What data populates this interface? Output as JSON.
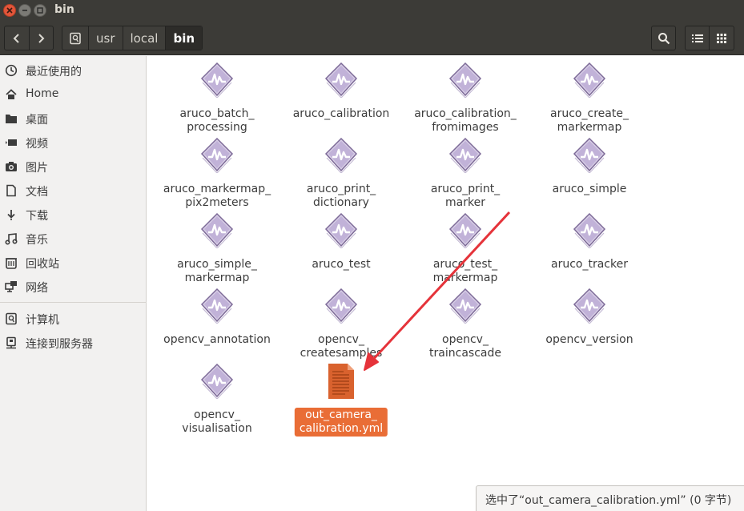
{
  "window": {
    "title": "bin"
  },
  "toolbar": {
    "back_icon": "chevron-left-icon",
    "forward_icon": "chevron-right-icon",
    "path": [
      "usr",
      "local",
      "bin"
    ],
    "root_icon": "drive-icon",
    "search_icon": "search-icon",
    "list_view_icon": "list-view-icon",
    "grid_view_icon": "grid-view-icon"
  },
  "sidebar": {
    "items": [
      {
        "label": "最近使用的",
        "icon": "clock-icon"
      },
      {
        "label": "Home",
        "icon": "home-icon"
      },
      {
        "label": "桌面",
        "icon": "folder-icon"
      },
      {
        "label": "视频",
        "icon": "video-icon"
      },
      {
        "label": "图片",
        "icon": "camera-icon"
      },
      {
        "label": "文档",
        "icon": "document-icon"
      },
      {
        "label": "下载",
        "icon": "download-icon"
      },
      {
        "label": "音乐",
        "icon": "music-icon"
      },
      {
        "label": "回收站",
        "icon": "trash-icon"
      },
      {
        "label": "网络",
        "icon": "network-icon"
      },
      {
        "label": "计算机",
        "icon": "computer-icon"
      },
      {
        "label": "连接到服务器",
        "icon": "server-icon"
      }
    ]
  },
  "files": [
    {
      "lines": [
        "aruco_batch_",
        "processing"
      ],
      "type": "executable"
    },
    {
      "lines": [
        "aruco_calibration"
      ],
      "type": "executable"
    },
    {
      "lines": [
        "aruco_calibration_",
        "fromimages"
      ],
      "type": "executable"
    },
    {
      "lines": [
        "aruco_create_",
        "markermap"
      ],
      "type": "executable"
    },
    {
      "lines": [
        "aruco_markermap_",
        "pix2meters"
      ],
      "type": "executable"
    },
    {
      "lines": [
        "aruco_print_",
        "dictionary"
      ],
      "type": "executable"
    },
    {
      "lines": [
        "aruco_print_",
        "marker"
      ],
      "type": "executable"
    },
    {
      "lines": [
        "aruco_simple"
      ],
      "type": "executable"
    },
    {
      "lines": [
        "aruco_simple_",
        "markermap"
      ],
      "type": "executable"
    },
    {
      "lines": [
        "aruco_test"
      ],
      "type": "executable"
    },
    {
      "lines": [
        "aruco_test_",
        "markermap"
      ],
      "type": "executable"
    },
    {
      "lines": [
        "aruco_tracker"
      ],
      "type": "executable"
    },
    {
      "lines": [
        "opencv_annotation"
      ],
      "type": "executable"
    },
    {
      "lines": [
        "opencv_",
        "createsamples"
      ],
      "type": "executable"
    },
    {
      "lines": [
        "opencv_",
        "traincascade"
      ],
      "type": "executable"
    },
    {
      "lines": [
        "opencv_version"
      ],
      "type": "executable"
    },
    {
      "lines": [
        "opencv_",
        "visualisation"
      ],
      "type": "executable"
    },
    {
      "lines": [
        "out_camera_",
        "calibration.yml"
      ],
      "type": "text-document",
      "selected": true
    }
  ],
  "status": {
    "text": "选中了“out_camera_calibration.yml” (0 字节)"
  },
  "colors": {
    "selection": "#e96d36",
    "arrow": "#e5333a",
    "titlebar": "#3c3b37",
    "close_button": "#e2553a"
  }
}
